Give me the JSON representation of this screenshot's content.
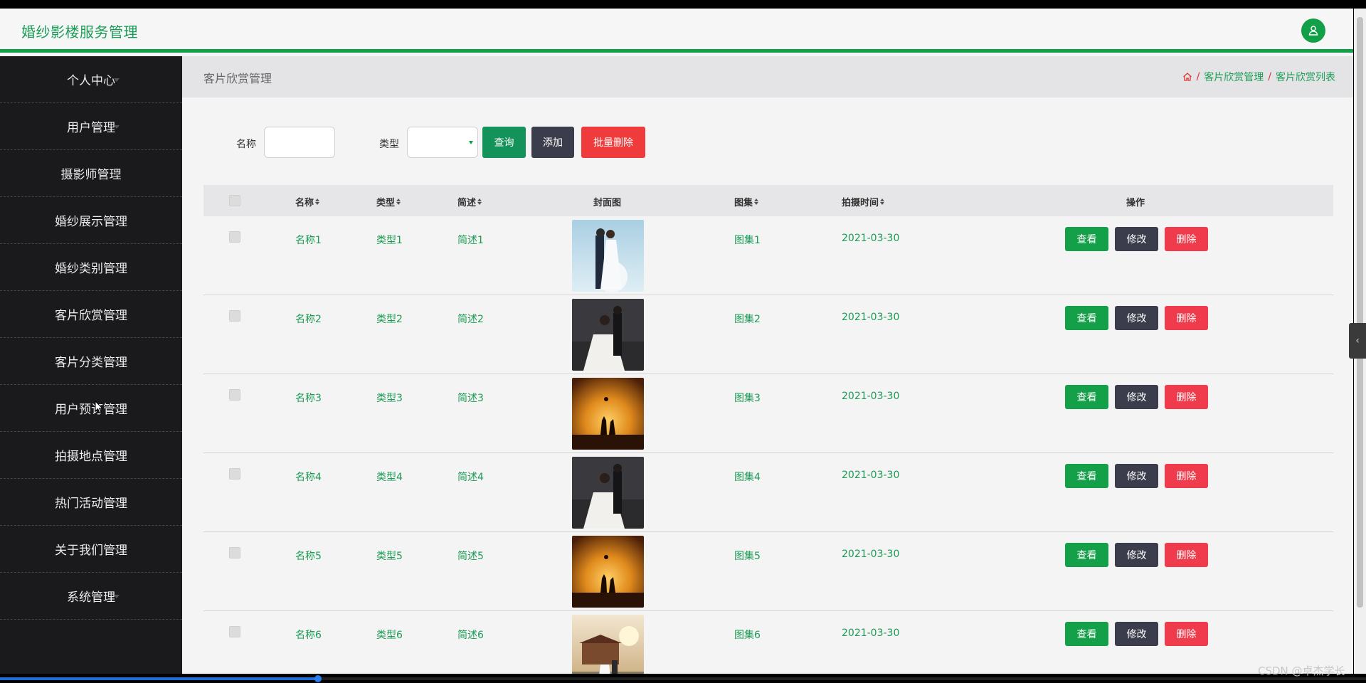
{
  "app": {
    "title": "婚纱影楼服务管理",
    "accent_color": "#11a048"
  },
  "header": {
    "avatar_icon": "user-icon"
  },
  "sidebar": {
    "items": [
      {
        "label": "个人中心"
      },
      {
        "label": "用户管理"
      },
      {
        "label": "摄影师管理"
      },
      {
        "label": "婚纱展示管理"
      },
      {
        "label": "婚纱类别管理"
      },
      {
        "label": "客片欣赏管理"
      },
      {
        "label": "客片分类管理"
      },
      {
        "label": "用户预订管理"
      },
      {
        "label": "拍摄地点管理"
      },
      {
        "label": "热门活动管理"
      },
      {
        "label": "关于我们管理"
      },
      {
        "label": "系统管理"
      }
    ]
  },
  "page": {
    "heading": "客片欣赏管理",
    "breadcrumb": {
      "home_icon": "home-icon",
      "separator": "/",
      "items": [
        "客片欣赏管理",
        "客片欣赏列表"
      ]
    }
  },
  "search": {
    "name_label": "名称",
    "name_value": "",
    "type_label": "类型",
    "type_value": "",
    "query_label": "查询",
    "add_label": "添加",
    "batch_delete_label": "批量删除"
  },
  "table": {
    "columns": {
      "name": "名称",
      "type": "类型",
      "summary": "简述",
      "cover": "封面图",
      "gallery": "图集",
      "shoot_time": "拍摄时间",
      "actions": "操作"
    },
    "rows": [
      {
        "name": "名称1",
        "type": "类型1",
        "summary": "简述1",
        "gallery": "图集1",
        "shoot_time": "2021-03-30",
        "cover": "couple-studio-photo"
      },
      {
        "name": "名称2",
        "type": "类型2",
        "summary": "简述2",
        "gallery": "图集2",
        "shoot_time": "2021-03-30",
        "cover": "couple-dark-photo"
      },
      {
        "name": "名称3",
        "type": "类型3",
        "summary": "简述3",
        "gallery": "图集3",
        "shoot_time": "2021-03-30",
        "cover": "sunset-silhouette-photo"
      },
      {
        "name": "名称4",
        "type": "类型4",
        "summary": "简述4",
        "gallery": "图集4",
        "shoot_time": "2021-03-30",
        "cover": "couple-dark-photo"
      },
      {
        "name": "名称5",
        "type": "类型5",
        "summary": "简述5",
        "gallery": "图集5",
        "shoot_time": "2021-03-30",
        "cover": "sunset-silhouette-photo"
      },
      {
        "name": "名称6",
        "type": "类型6",
        "summary": "简述6",
        "gallery": "图集6",
        "shoot_time": "2021-03-30",
        "cover": "outdoor-temple-photo"
      }
    ],
    "action_labels": {
      "view": "查看",
      "edit": "修改",
      "delete": "删除"
    }
  },
  "watermark": "CSDN @卓杰学长",
  "video_progress": 0.233,
  "colors": {
    "view_button": "#13a048",
    "edit_button": "#3c3d4c",
    "delete_button": "#ef3b4b"
  }
}
